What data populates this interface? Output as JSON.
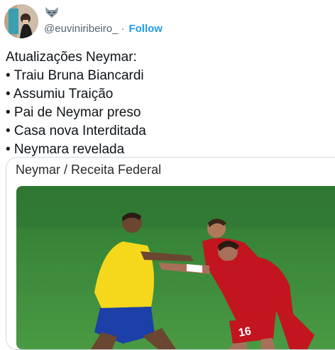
{
  "author": {
    "handle": "@euviniribeiro_",
    "separator": "·",
    "follow_label": "Follow",
    "badge_icon": "wolf-icon"
  },
  "tweet": {
    "lines": [
      "Atualizações Neymar:",
      "• Traiu Bruna Biancardi",
      "• Assumiu Traição",
      "• Pai de Neymar preso",
      "• Casa nova Interditada",
      "• Neymara revelada"
    ]
  },
  "card": {
    "title": "Neymar / Receita Federal",
    "image": "football-match-photo"
  },
  "colors": {
    "link": "#1d9bf0",
    "muted": "#536471",
    "pitch": "#3f8a3a",
    "brazil_yellow": "#f5d81b",
    "serbia_red": "#c3151f"
  }
}
